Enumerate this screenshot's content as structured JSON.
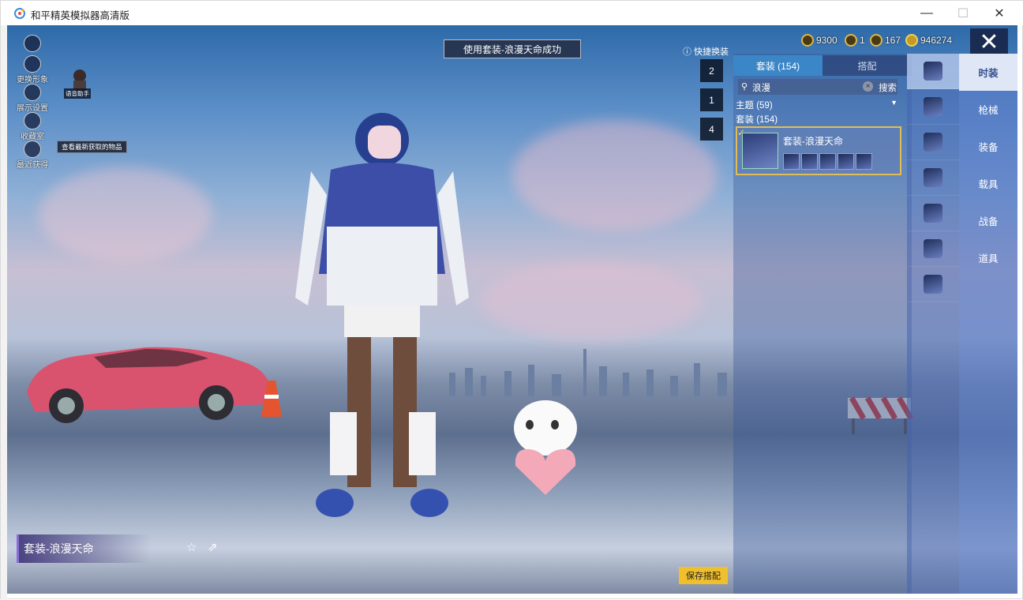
{
  "window": {
    "title": "和平精英模拟器高清版",
    "minimize_glyph": "—",
    "maximize_glyph": "☐",
    "close_glyph": "✕"
  },
  "resources": [
    {
      "name": "silver-coin",
      "value": "9300"
    },
    {
      "name": "token",
      "value": "1"
    },
    {
      "name": "medal",
      "value": "167"
    },
    {
      "name": "gold-coin",
      "value": "946274"
    }
  ],
  "toast": "使用套装-浪漫天命成功",
  "quick_change": {
    "label": "快捷换装",
    "slots": [
      "2",
      "1",
      "4"
    ]
  },
  "panel": {
    "tabs": [
      {
        "label": "套装 (154)",
        "active": true
      },
      {
        "label": "搭配",
        "active": false
      }
    ],
    "search": {
      "value": "浪漫",
      "button": "搜索"
    },
    "theme_header": "主题 (59)",
    "suit_header": "套装 (154)",
    "card": {
      "name": "套装-浪漫天命",
      "check": "✓",
      "equipped": true
    }
  },
  "side_tabs": [
    {
      "label": "时装",
      "active": true
    },
    {
      "label": "枪械",
      "active": false
    },
    {
      "label": "装备",
      "active": false
    },
    {
      "label": "载具",
      "active": false
    },
    {
      "label": "战备",
      "active": false
    },
    {
      "label": "道具",
      "active": false
    }
  ],
  "left_menu": {
    "change_look": "更换形象",
    "display_settings": "展示设置",
    "collection": "收藏室",
    "recent": "最近获得",
    "tooltip": "查看最新获取的物品",
    "assistant": "语音助手"
  },
  "outfit_name": "套装-浪漫天命",
  "save_button": "保存搭配",
  "colors": {
    "accent_gold": "#efbf2c",
    "tab_active": "#3b86c7",
    "card_border": "#e1be54",
    "side_tab_active": "#dfe6f5"
  }
}
